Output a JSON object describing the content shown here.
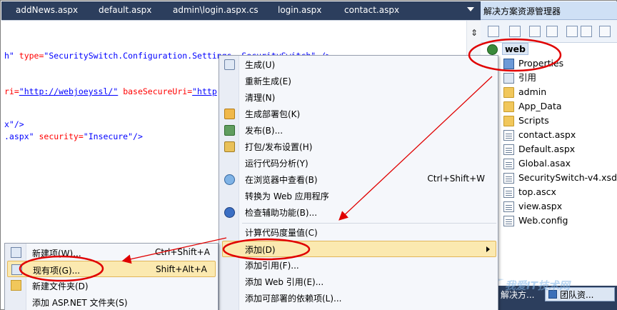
{
  "tabs": [
    "addNews.aspx",
    "default.aspx",
    "admin\\login.aspx.cs",
    "login.aspx",
    "contact.aspx"
  ],
  "editor": {
    "line1": {
      "pre": "h\"",
      "attr": " type=",
      "val": "\"SecuritySwitch.Configuration.Settings, SecuritySwitch\"",
      "post": " />"
    },
    "line2": {
      "pre": "ri=",
      "url": "\"http://webjoeyssl/\"",
      "attr": " baseSecureUri=",
      "url2": "\"http"
    },
    "line3": {
      "text": "x\"/>"
    },
    "line4": {
      "pre": ".aspx\"",
      "attr": " security=",
      "val": "\"Insecure\"",
      "post": "/>"
    }
  },
  "solution_explorer": {
    "title": "解决方案资源管理器",
    "root": "web",
    "items": [
      {
        "label": "Properties",
        "icon": "properties-icon"
      },
      {
        "label": "引用",
        "icon": "references-icon"
      },
      {
        "label": "admin",
        "icon": "folder-icon"
      },
      {
        "label": "App_Data",
        "icon": "folder-icon"
      },
      {
        "label": "Scripts",
        "icon": "folder-icon"
      },
      {
        "label": "contact.aspx",
        "icon": "aspx-file-icon"
      },
      {
        "label": "Default.aspx",
        "icon": "aspx-file-icon"
      },
      {
        "label": "Global.asax",
        "icon": "asax-file-icon"
      },
      {
        "label": "SecuritySwitch-v4.xsd",
        "icon": "xsd-file-icon"
      },
      {
        "label": "top.ascx",
        "icon": "ascx-file-icon"
      },
      {
        "label": "view.aspx",
        "icon": "aspx-file-icon"
      },
      {
        "label": "Web.config",
        "icon": "config-file-icon"
      }
    ],
    "bottom_tab1": "解决方...",
    "bottom_tab2": "团队资..."
  },
  "context_menu": {
    "items": [
      {
        "label": "生成(U)",
        "shortcut": "",
        "icon": "build-icon"
      },
      {
        "label": "重新生成(E)",
        "shortcut": "",
        "icon": ""
      },
      {
        "label": "清理(N)",
        "shortcut": "",
        "icon": ""
      },
      {
        "label": "生成部署包(K)",
        "shortcut": "",
        "icon": "package-icon"
      },
      {
        "label": "发布(B)...",
        "shortcut": "",
        "icon": "publish-icon"
      },
      {
        "label": "打包/发布设置(H)",
        "shortcut": "",
        "icon": "package-settings-icon"
      },
      {
        "label": "运行代码分析(Y)",
        "shortcut": "",
        "icon": ""
      },
      {
        "label": "在浏览器中查看(B)",
        "shortcut": "Ctrl+Shift+W",
        "icon": "browser-icon"
      },
      {
        "label": "转换为 Web 应用程序",
        "shortcut": "",
        "icon": ""
      },
      {
        "label": "检查辅助功能(B)...",
        "shortcut": "",
        "icon": "accessibility-icon"
      },
      {
        "label": "计算代码度量值(C)",
        "shortcut": "",
        "icon": ""
      },
      {
        "label": "添加(D)",
        "shortcut": "",
        "icon": ""
      },
      {
        "label": "添加引用(F)...",
        "shortcut": "",
        "icon": ""
      },
      {
        "label": "添加 Web 引用(E)...",
        "shortcut": "",
        "icon": ""
      },
      {
        "label": "添加可部署的依赖项(L)...",
        "shortcut": "",
        "icon": ""
      }
    ]
  },
  "submenu": {
    "items": [
      {
        "label": "新建项(W)...",
        "shortcut": "Ctrl+Shift+A"
      },
      {
        "label": "现有项(G)...",
        "shortcut": "Shift+Alt+A"
      },
      {
        "label": "新建文件夹(D)",
        "shortcut": ""
      },
      {
        "label": "添加 ASP.NET 文件夹(S)",
        "shortcut": ""
      }
    ]
  },
  "watermark": "我爱IT技术网",
  "colors": {
    "tab_strip": "#2c3e5d",
    "highlight": "#fbe9b0",
    "annotation_red": "#e00000"
  }
}
